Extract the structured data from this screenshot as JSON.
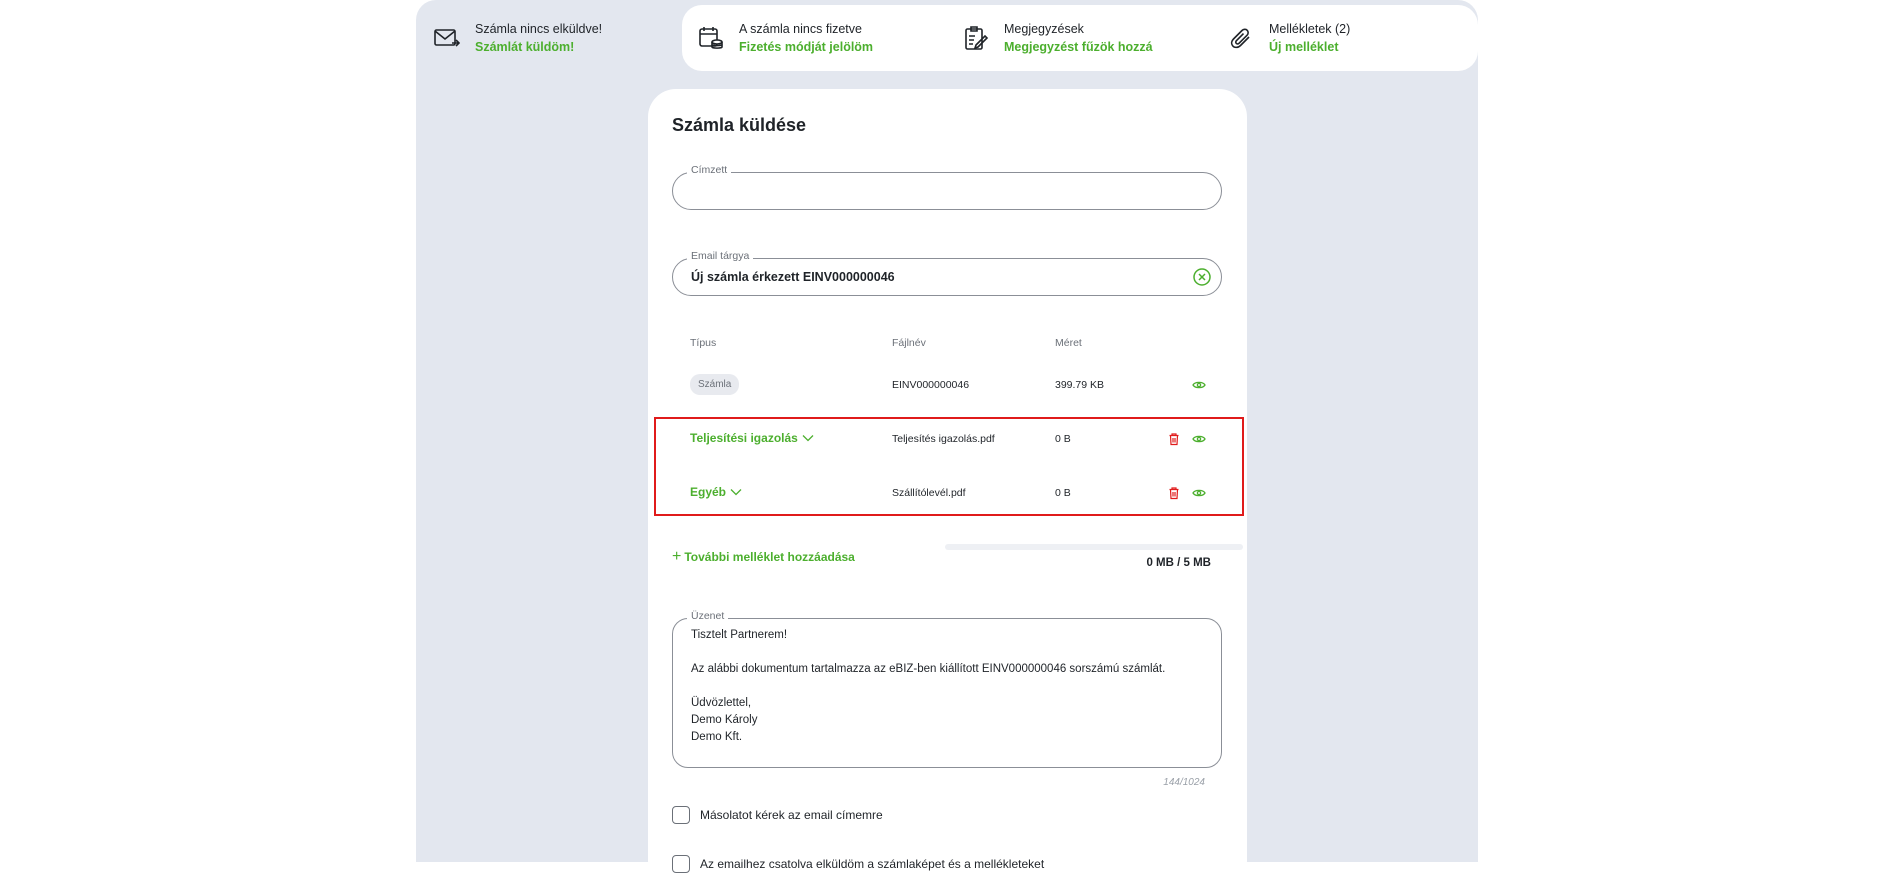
{
  "tabs": [
    {
      "title": "Számla nincs elküldve!",
      "action": "Számlát küldöm!",
      "icon": "mail-send-icon"
    },
    {
      "title": "A számla nincs fizetve",
      "action": "Fizetés módját jelölöm",
      "icon": "calendar-coins-icon"
    },
    {
      "title": "Megjegyzések",
      "action": "Megjegyzést fűzök hozzá",
      "icon": "notes-edit-icon"
    },
    {
      "title": "Mellékletek (2)",
      "action": "Új melléklet",
      "icon": "paperclip-icon"
    }
  ],
  "form": {
    "title": "Számla küldése",
    "recipient": {
      "label": "Címzett",
      "value": ""
    },
    "subject": {
      "label": "Email tárgya",
      "value": "Új számla érkezett EINV000000046"
    }
  },
  "attachments": {
    "headers": {
      "type": "Típus",
      "filename": "Fájlnév",
      "size": "Méret"
    },
    "rows": [
      {
        "type": "Számla",
        "filename": "EINV000000046",
        "size": "399.79 KB"
      },
      {
        "type": "Teljesítési igazolás",
        "filename": "Teljesítés igazolás.pdf",
        "size": "0 B"
      },
      {
        "type": "Egyéb",
        "filename": "Szállítólevél.pdf",
        "size": "0 B"
      }
    ],
    "add_label": "További melléklet hozzáadása",
    "usage_text": "0 MB / 5 MB",
    "usage_fraction": 0
  },
  "message": {
    "label": "Üzenet",
    "lines": [
      "Tisztelt Partnerem!",
      "",
      "Az alábbi dokumentum tartalmazza az eBIZ-ben kiállított EINV000000046 sorszámú számlát.",
      "",
      "Üdvözlettel,",
      "Demo Károly",
      "Demo Kft."
    ],
    "counter": "144/1024"
  },
  "options": {
    "copy_label": "Másolatot kérek az email címemre",
    "attach_label": "Az emailhez csatolva elküldöm a számlaképet és a mellékleteket"
  },
  "colors": {
    "accent": "#4caf2e",
    "danger": "#e01b1b",
    "background": "#e3e7ef"
  }
}
